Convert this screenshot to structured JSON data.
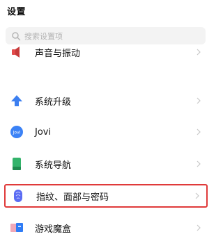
{
  "header": {
    "title": "设置"
  },
  "search": {
    "placeholder": "搜索设置项"
  },
  "items": [
    {
      "label": "声音与振动",
      "icon": "speaker-icon",
      "color": "#e24b4b"
    },
    {
      "label": "系统升级",
      "icon": "upgrade-arrow-icon",
      "color": "#3c7ff0"
    },
    {
      "label": "Jovi",
      "icon": "jovi-icon",
      "color": "#3b82f6"
    },
    {
      "label": "系统导航",
      "icon": "navigation-phone-icon",
      "color": "#33b36b"
    },
    {
      "label": "指纹、面部与密码",
      "icon": "fingerprint-icon",
      "color": "#5b6cf3"
    },
    {
      "label": "游戏魔盒",
      "icon": "game-box-icon",
      "color": "#2f7cf6"
    }
  ],
  "highlight_color": "#e03a3a"
}
